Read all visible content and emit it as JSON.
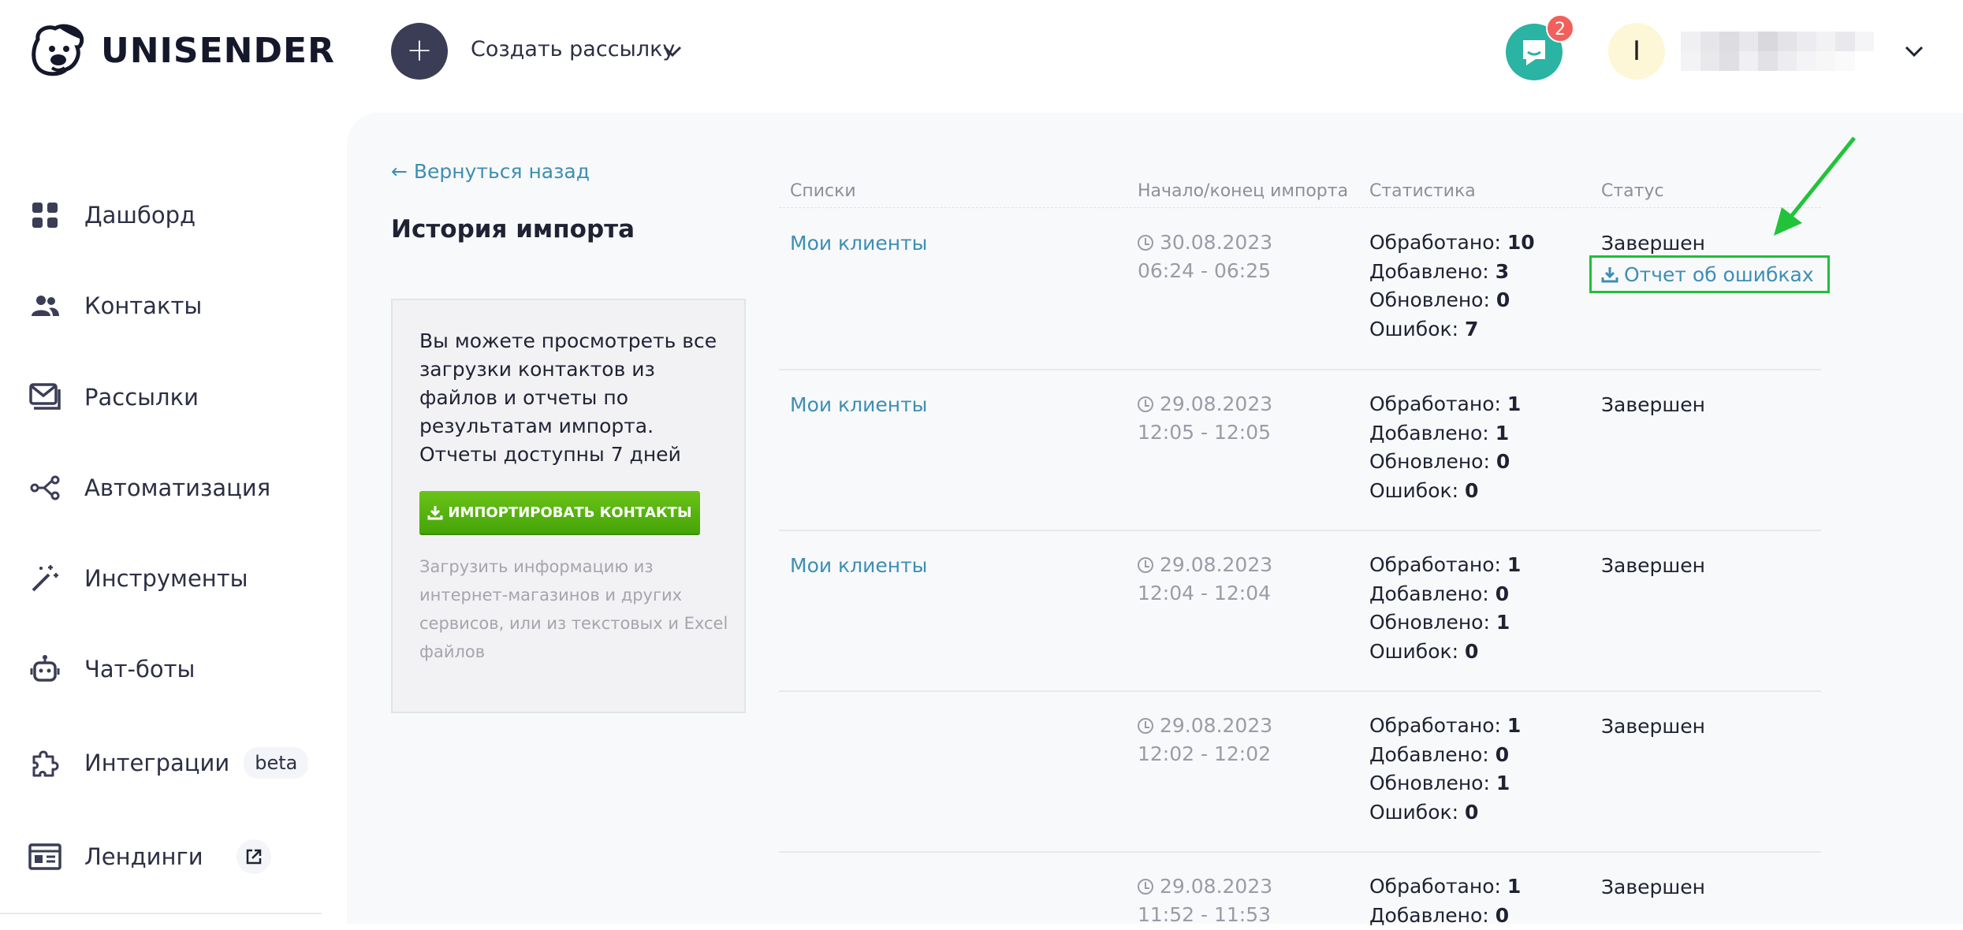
{
  "header": {
    "logo_text": "UNISENDER",
    "create_label": "Создать рассылку",
    "chat_badge": "2",
    "avatar_letter": "I"
  },
  "sidebar": {
    "items": [
      {
        "label": "Дашборд",
        "icon": "dashboard-icon"
      },
      {
        "label": "Контакты",
        "icon": "contacts-icon"
      },
      {
        "label": "Рассылки",
        "icon": "mail-icon"
      },
      {
        "label": "Автоматизация",
        "icon": "automation-icon"
      },
      {
        "label": "Инструменты",
        "icon": "magic-wand-icon"
      },
      {
        "label": "Чат-боты",
        "icon": "robot-icon"
      },
      {
        "label": "Интеграции",
        "icon": "puzzle-icon",
        "badge": "beta"
      },
      {
        "label": "Лендинги",
        "icon": "landing-icon"
      }
    ]
  },
  "main": {
    "back_link": "← Вернуться назад",
    "title": "История импорта",
    "info_text": "Вы можете просмотреть все загрузки контактов из файлов и отчеты по результатам импорта. Отчеты доступны 7 дней",
    "import_button": "ИМПОРТИРОВАТЬ КОНТАКТЫ",
    "info_note": "Загрузить информацию из интернет-магазинов и других сервисов, или из текстовых и Excel файлов"
  },
  "table": {
    "headers": [
      "Списки",
      "Начало/конец импорта",
      "Статистика",
      "Статус"
    ],
    "stat_labels": {
      "processed": "Обработано:",
      "added": "Добавлено:",
      "updated": "Обновлено:",
      "errors": "Ошибок:"
    },
    "error_report_link": "Отчет об ошибках",
    "rows": [
      {
        "list": "Мои клиенты",
        "date": "30.08.2023",
        "time": "06:24 - 06:25",
        "processed": "10",
        "added": "3",
        "updated": "0",
        "errors": "7",
        "status": "Завершен"
      },
      {
        "list": "Мои клиенты",
        "date": "29.08.2023",
        "time": "12:05 - 12:05",
        "processed": "1",
        "added": "1",
        "updated": "0",
        "errors": "0",
        "status": "Завершен"
      },
      {
        "list": "Мои клиенты",
        "date": "29.08.2023",
        "time": "12:04 - 12:04",
        "processed": "1",
        "added": "0",
        "updated": "1",
        "errors": "0",
        "status": "Завершен"
      },
      {
        "list": "",
        "date": "29.08.2023",
        "time": "12:02 - 12:02",
        "processed": "1",
        "added": "0",
        "updated": "1",
        "errors": "0",
        "status": "Завершен"
      },
      {
        "list": "",
        "date": "29.08.2023",
        "time": "11:52 - 11:53",
        "processed": "1",
        "added": "0",
        "updated": "",
        "errors": "",
        "status": "Завершен"
      }
    ]
  },
  "colors": {
    "accent_link": "#3c8eb4",
    "import_button": "#4fae0c",
    "highlight_box": "#1fbf3a",
    "annotation_arrow": "#22c33a"
  }
}
